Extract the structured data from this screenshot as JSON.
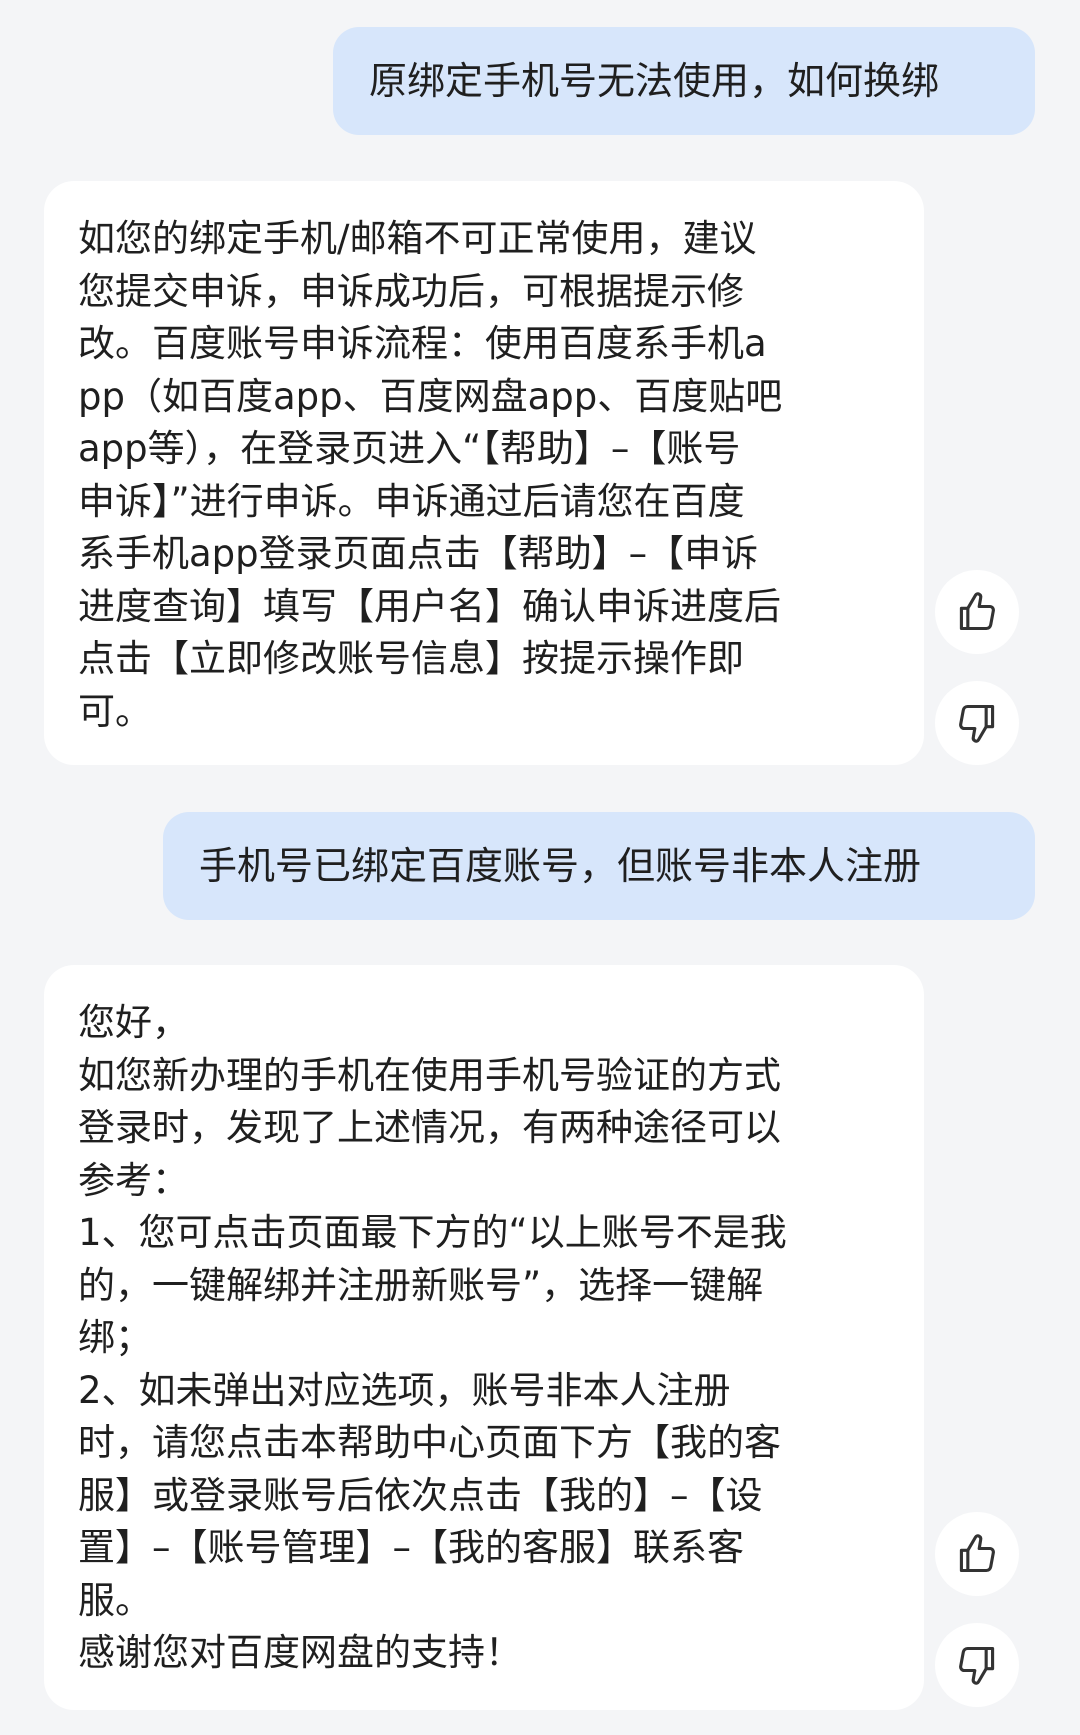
{
  "messages": [
    {
      "role": "user",
      "text": "原绑定手机号无法使用，如何换绑"
    },
    {
      "role": "assistant",
      "lines": [
        "如您的绑定手机/邮箱不可正常使用，建议",
        "您提交申诉，申诉成功后，可根据提示修",
        "改。百度账号申诉流程：使用百度系手机a",
        "pp（如百度app、百度网盘app、百度贴吧",
        "app等），在登录页进入“【帮助】–【账号",
        "申诉】”进行申诉。申诉通过后请您在百度",
        "系手机app登录页面点击【帮助】–【申诉",
        "进度查询】填写【用户名】确认申诉进度后",
        "点击【立即修改账号信息】按提示操作即",
        "可。"
      ]
    },
    {
      "role": "user",
      "text": "手机号已绑定百度账号，但账号非本人注册"
    },
    {
      "role": "assistant",
      "lines": [
        "您好，",
        "如您新办理的手机在使用手机号验证的方式",
        "登录时，发现了上述情况，有两种途径可以",
        "参考：",
        "1、您可点击页面最下方的“以上账号不是我",
        "的，一键解绑并注册新账号”，选择一键解",
        "绑；",
        "2、如未弹出对应选项，账号非本人注册",
        "时，请您点击本帮助中心页面下方【我的客",
        "服】或登录账号后依次点击【我的】–【设",
        "置】–【账号管理】–【我的客服】联系客",
        "服。",
        "感谢您对百度网盘的支持！"
      ]
    }
  ],
  "icons": {
    "like": "thumbs-up-icon",
    "dislike": "thumbs-down-icon"
  },
  "colors": {
    "background": "#f4f5f7",
    "user_bubble": "#d7e6fb",
    "assistant_bubble": "#ffffff",
    "text": "#1f1f1f",
    "icon": "#333333"
  }
}
